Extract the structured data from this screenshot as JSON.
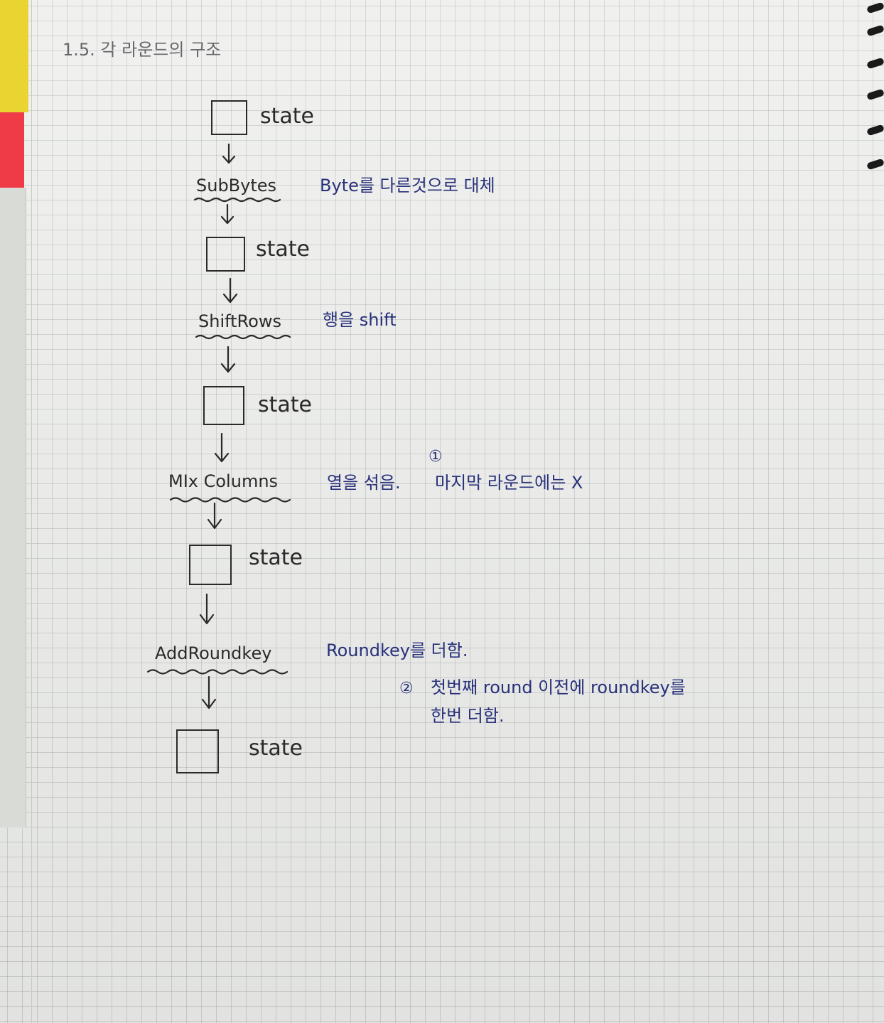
{
  "title": "1.5. 각 라운드의 구조",
  "nodes": [
    {
      "label": "state"
    },
    {
      "label": "state"
    },
    {
      "label": "state"
    },
    {
      "label": "state"
    },
    {
      "label": "state"
    }
  ],
  "operations": [
    {
      "name": "SubBytes",
      "note": "Byte를 다른것으로 대체"
    },
    {
      "name": "ShiftRows",
      "note": "행을 shift"
    },
    {
      "name": "MIx Columns",
      "note": "열을 섞음.",
      "marker": "①",
      "extra": "마지막 라운드에는 X"
    },
    {
      "name": "AddRoundkey",
      "note": "Roundkey를 더함."
    }
  ],
  "footnote": {
    "marker": "②",
    "line1": "첫번째 round 이전에 roundkey를",
    "line2": "한번 더함."
  },
  "colors": {
    "pen": "#2a2a2a",
    "blue_ink": "#28307a",
    "grid": "#7a8690"
  }
}
